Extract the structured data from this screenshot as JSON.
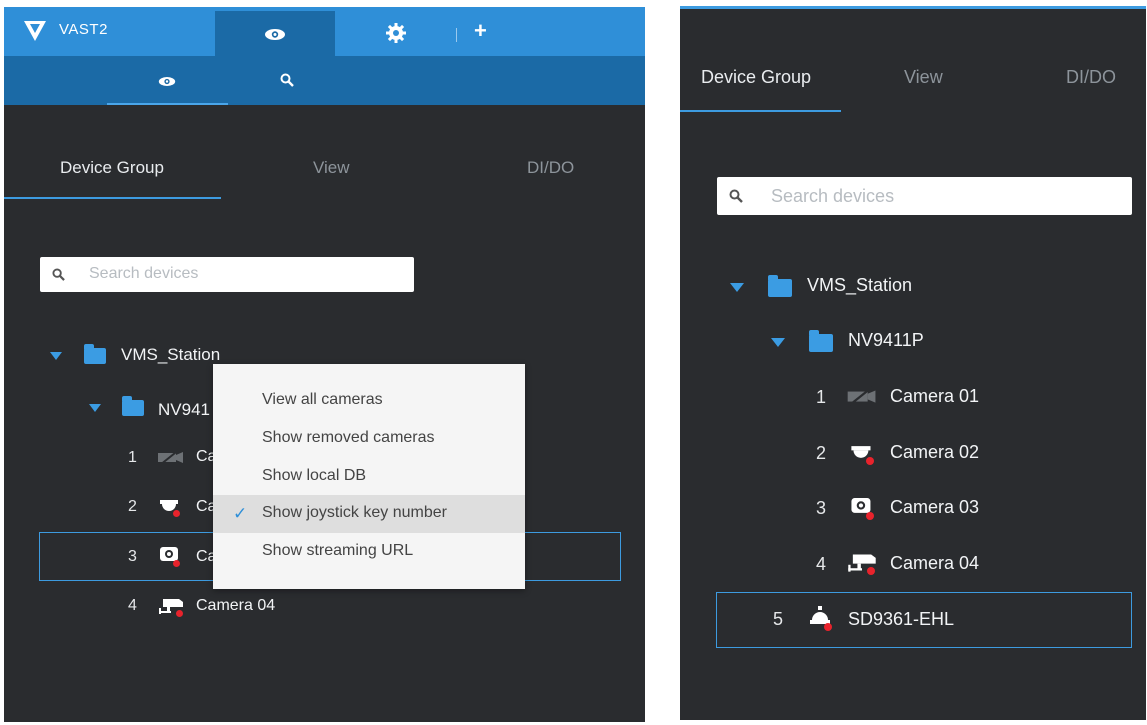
{
  "left": {
    "app_name": "VAST2",
    "tabs": [
      "Device Group",
      "View",
      "DI/DO"
    ],
    "search_placeholder": "Search devices",
    "tree": {
      "root": "VMS_Station",
      "station": "NV941",
      "cameras": [
        {
          "num": "1",
          "label": "Ca"
        },
        {
          "num": "2",
          "label": "Ca"
        },
        {
          "num": "3",
          "label": "Ca"
        },
        {
          "num": "4",
          "label": "Camera 04"
        }
      ]
    },
    "context_menu": {
      "items": [
        "View all cameras",
        "Show removed cameras",
        "Show local DB",
        "Show joystick key number",
        "Show streaming URL"
      ],
      "checked_index": 3
    }
  },
  "right": {
    "tabs": [
      "Device Group",
      "View",
      "DI/DO"
    ],
    "search_placeholder": "Search devices",
    "tree": {
      "root": "VMS_Station",
      "station": "NV9411P",
      "devices": [
        {
          "num": "1",
          "label": "Camera 01"
        },
        {
          "num": "2",
          "label": "Camera 02"
        },
        {
          "num": "3",
          "label": "Camera 03"
        },
        {
          "num": "4",
          "label": "Camera 04"
        },
        {
          "num": "5",
          "label": "SD9361-EHL"
        }
      ]
    }
  },
  "colors": {
    "accent": "#2f8fd8",
    "panel": "#2a2c2f",
    "offline_dot": "#e8232c"
  }
}
